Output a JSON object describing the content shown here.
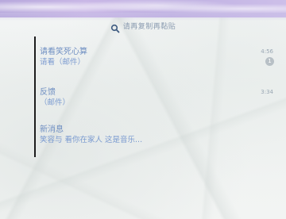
{
  "search": {
    "placeholder": "请再复制再黏贴"
  },
  "chats": [
    {
      "name": "请看笑死心算",
      "preview": "请看（邮件）",
      "time": "4:56",
      "unread": "1"
    },
    {
      "name": "反馈",
      "preview": "（邮件）",
      "time": "3:34",
      "unread": ""
    },
    {
      "name": "新消息",
      "preview": "笑容与 看你在家人 这是音乐...",
      "time": "",
      "unread": ""
    }
  ],
  "colors": {
    "accent_text": "#6f8fc2",
    "header_sky": "#c2b3e4"
  }
}
